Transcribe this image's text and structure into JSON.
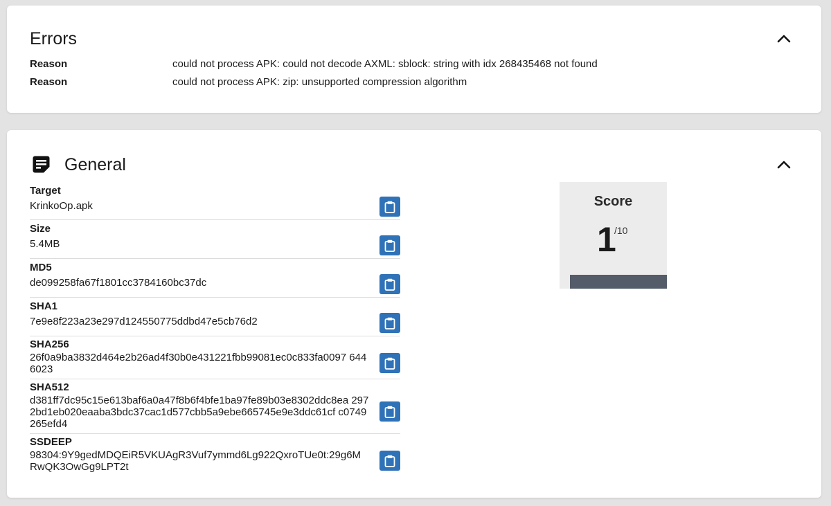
{
  "colors": {
    "background": "#e3e3e3",
    "card": "#ffffff",
    "copy_button": "#2f72b7",
    "score_bar": "#545c6a"
  },
  "errors": {
    "title": "Errors",
    "collapse_icon": "chevron-up-icon",
    "rows": [
      {
        "label": "Reason",
        "message": "could not process APK: could not decode AXML: sblock: string with idx 268435468 not found"
      },
      {
        "label": "Reason",
        "message": "could not process APK: zip: unsupported compression algorithm"
      }
    ]
  },
  "general": {
    "title": "General",
    "icon": "sticky-note-icon",
    "collapse_icon": "chevron-up-icon",
    "copy_icon": "clipboard-icon",
    "fields": [
      {
        "label": "Target",
        "value": "KrinkoOp.apk"
      },
      {
        "label": "Size",
        "value": "5.4MB"
      },
      {
        "label": "MD5",
        "value": "de099258fa67f1801cc3784160bc37dc"
      },
      {
        "label": "SHA1",
        "value": "7e9e8f223a23e297d124550775ddbd47e5cb76d2"
      },
      {
        "label": "SHA256",
        "value": "26f0a9ba3832d464e2b26ad4f30b0e431221fbb99081ec0c833fa0097 6446023"
      },
      {
        "label": "SHA512",
        "value": "d381ff7dc95c15e613baf6a0a47f8b6f4bfe1ba97fe89b03e8302ddc8ea 2972bd1eb020eaaba3bdc37cac1d577cbb5a9ebe665745e9e3ddc61cf c0749265efd4"
      },
      {
        "label": "SSDEEP",
        "value": "98304:9Y9gedMDQEiR5VKUAgR3Vuf7ymmd6Lg922QxroTUe0t:29g6M RwQK3OwGg9LPT2t"
      }
    ],
    "score": {
      "label": "Score",
      "value": "1",
      "max": "/10"
    }
  }
}
